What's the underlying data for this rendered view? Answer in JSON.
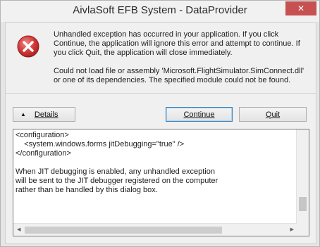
{
  "window": {
    "title": "AivlaSoft EFB System - DataProvider",
    "close_glyph": "✕"
  },
  "icon": "error-icon",
  "message": {
    "line1": "Unhandled exception has occurred in your application. If you click",
    "line2": "Continue, the application will ignore this error and attempt to continue. If",
    "line3": "you click Quit, the application will close immediately.",
    "line4": "Could not load file or assembly 'Microsoft.FlightSimulator.SimConnect.dll'",
    "line5": "or one of its dependencies. The specified module could not be found."
  },
  "buttons": {
    "details_arrow": "▲",
    "details_label": "Details",
    "continue_label": "Continue",
    "quit_label": "Quit"
  },
  "details_text": "<configuration>\n    <system.windows.forms jitDebugging=\"true\" />\n</configuration>\n\nWhen JIT debugging is enabled, any unhandled exception\nwill be sent to the JIT debugger registered on the computer\nrather than be handled by this dialog box.",
  "colors": {
    "close_button": "#c75050",
    "error_icon": "#d43c3c",
    "default_button_border": "#3c7fb1"
  }
}
